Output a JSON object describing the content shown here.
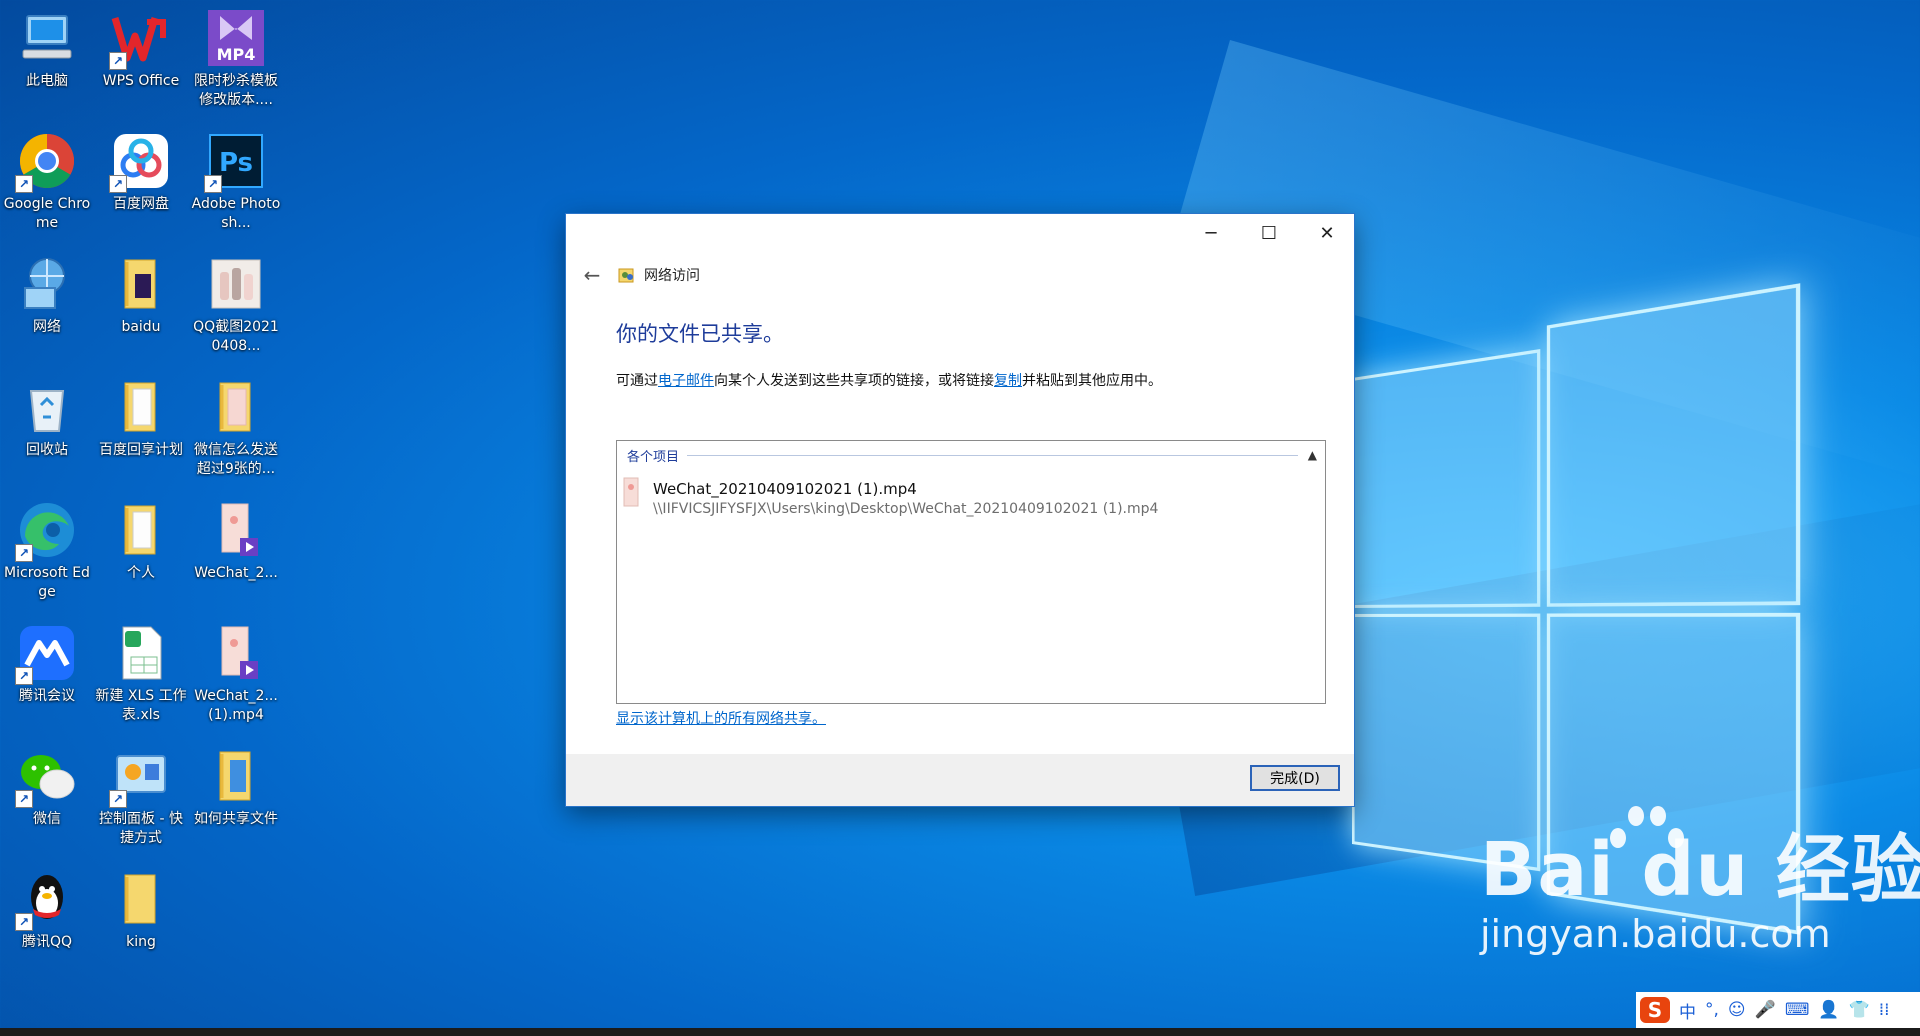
{
  "desktop": {
    "icons": [
      {
        "label": "此电脑"
      },
      {
        "label": "WPS Office"
      },
      {
        "label": "限时秒杀模板修改版本...."
      },
      {
        "label": "Google Chrome"
      },
      {
        "label": "百度网盘"
      },
      {
        "label": "Adobe Photosh..."
      },
      {
        "label": "网络"
      },
      {
        "label": "baidu"
      },
      {
        "label": "QQ截图20210408..."
      },
      {
        "label": "回收站"
      },
      {
        "label": "百度回享计划"
      },
      {
        "label": "微信怎么发送超过9张的..."
      },
      {
        "label": "Microsoft Edge"
      },
      {
        "label": "个人"
      },
      {
        "label": "WeChat_2..."
      },
      {
        "label": "腾讯会议"
      },
      {
        "label": "新建 XLS 工作表.xls"
      },
      {
        "label": "WeChat_2...(1).mp4"
      },
      {
        "label": "微信"
      },
      {
        "label": "控制面板 - 快捷方式"
      },
      {
        "label": "如何共享文件"
      },
      {
        "label": "腾讯QQ"
      },
      {
        "label": "king"
      }
    ],
    "icon_texts": {
      "mp4": "MP4",
      "ps": "Ps"
    }
  },
  "dialog": {
    "nav_title": "网络访问",
    "heading": "你的文件已共享。",
    "desc_prefix": "可通过",
    "email_link": "电子邮件",
    "desc_mid": "向某个人发送到这些共享项的链接，或将链接",
    "copy_link": "复制",
    "desc_suffix": "并粘贴到其他应用中。",
    "group_title": "各个项目",
    "file_name": "WeChat_20210409102021 (1).mp4",
    "file_path": "\\\\IIFVICSJIFYSFJX\\Users\\king\\Desktop\\WeChat_20210409102021 (1).mp4",
    "show_all_link": "显示该计算机上的所有网络共享。",
    "finish_button": "完成(D)"
  },
  "watermark": {
    "top": "Bai du 经验",
    "bottom": "jingyan.baidu.com"
  },
  "ime": {
    "logo": "S",
    "items": [
      "中",
      "°,",
      "☺",
      "🎤",
      "⌨",
      "👤",
      "👕",
      "⁞⁞"
    ]
  },
  "colors": {
    "desktop_blue": "#0a8ae6",
    "dialog_heading": "#1e3c9a",
    "link": "#0066cc",
    "ime_red": "#e8440e"
  }
}
